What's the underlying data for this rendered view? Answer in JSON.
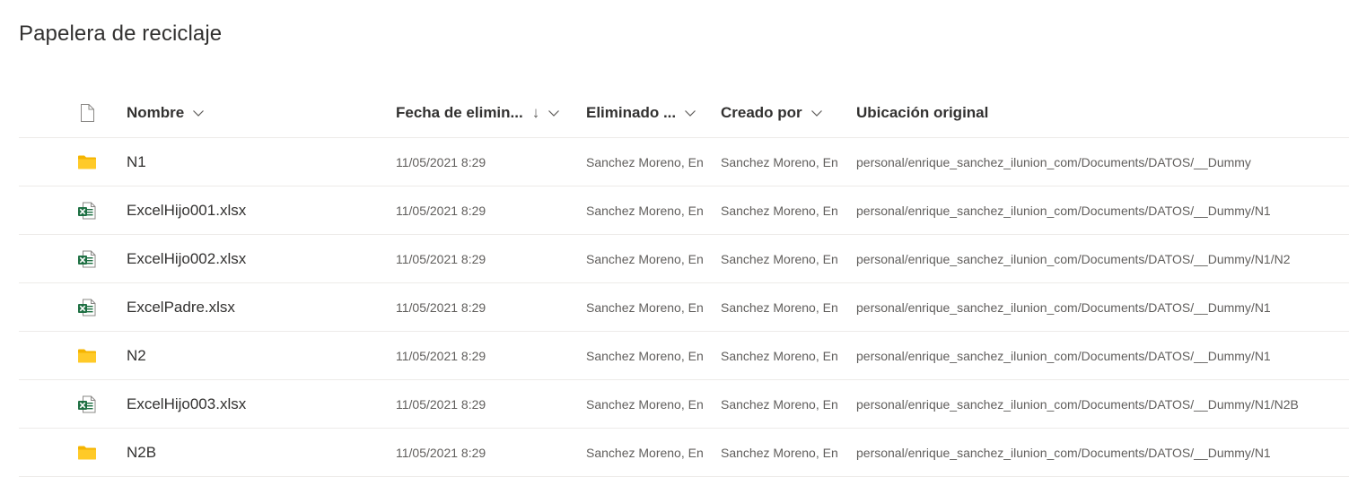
{
  "page": {
    "title": "Papelera de reciclaje"
  },
  "columns": {
    "type_icon": "document-icon",
    "name": "Nombre",
    "date_deleted": "Fecha de elimin...",
    "sort_indicator": "↓",
    "deleted_by": "Eliminado ...",
    "created_by": "Creado por",
    "original_location": "Ubicación original"
  },
  "rows": [
    {
      "icon": "folder-icon",
      "name": "N1",
      "date_deleted": "11/05/2021 8:29",
      "deleted_by": "Sanchez Moreno, En",
      "created_by": "Sanchez Moreno, En",
      "original_location": "personal/enrique_sanchez_ilunion_com/Documents/DATOS/__Dummy"
    },
    {
      "icon": "excel-file-icon",
      "name": "ExcelHijo001.xlsx",
      "date_deleted": "11/05/2021 8:29",
      "deleted_by": "Sanchez Moreno, En",
      "created_by": "Sanchez Moreno, En",
      "original_location": "personal/enrique_sanchez_ilunion_com/Documents/DATOS/__Dummy/N1"
    },
    {
      "icon": "excel-file-icon",
      "name": "ExcelHijo002.xlsx",
      "date_deleted": "11/05/2021 8:29",
      "deleted_by": "Sanchez Moreno, En",
      "created_by": "Sanchez Moreno, En",
      "original_location": "personal/enrique_sanchez_ilunion_com/Documents/DATOS/__Dummy/N1/N2"
    },
    {
      "icon": "excel-file-icon",
      "name": "ExcelPadre.xlsx",
      "date_deleted": "11/05/2021 8:29",
      "deleted_by": "Sanchez Moreno, En",
      "created_by": "Sanchez Moreno, En",
      "original_location": "personal/enrique_sanchez_ilunion_com/Documents/DATOS/__Dummy/N1"
    },
    {
      "icon": "folder-icon",
      "name": "N2",
      "date_deleted": "11/05/2021 8:29",
      "deleted_by": "Sanchez Moreno, En",
      "created_by": "Sanchez Moreno, En",
      "original_location": "personal/enrique_sanchez_ilunion_com/Documents/DATOS/__Dummy/N1"
    },
    {
      "icon": "excel-file-icon",
      "name": "ExcelHijo003.xlsx",
      "date_deleted": "11/05/2021 8:29",
      "deleted_by": "Sanchez Moreno, En",
      "created_by": "Sanchez Moreno, En",
      "original_location": "personal/enrique_sanchez_ilunion_com/Documents/DATOS/__Dummy/N1/N2B"
    },
    {
      "icon": "folder-icon",
      "name": "N2B",
      "date_deleted": "11/05/2021 8:29",
      "deleted_by": "Sanchez Moreno, En",
      "created_by": "Sanchez Moreno, En",
      "original_location": "personal/enrique_sanchez_ilunion_com/Documents/DATOS/__Dummy/N1"
    }
  ],
  "colors": {
    "folder": "#FFCA28",
    "folder_back": "#F5B400",
    "excel_green": "#1D6F42",
    "text_primary": "#323130",
    "text_secondary": "#605e5c",
    "divider": "#edebe9"
  }
}
